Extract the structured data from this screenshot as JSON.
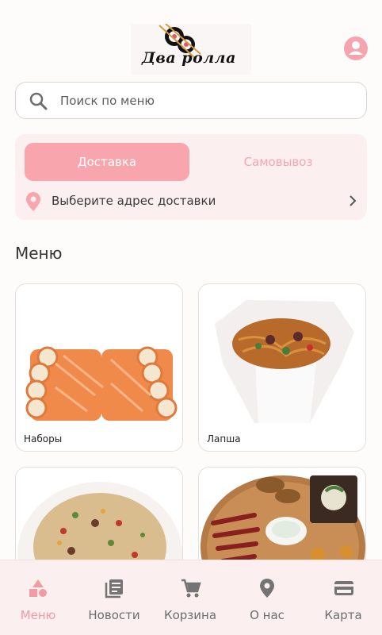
{
  "brand": {
    "name": "Два ролла",
    "accent": "#f8a5ae",
    "accent_dark": "#f39aa5",
    "background": "#fefbfb",
    "panel": "#fbefef"
  },
  "header": {
    "profile_icon": "user-circle-icon"
  },
  "search": {
    "placeholder": "Поиск по меню",
    "value": "",
    "icon": "search-icon"
  },
  "order_mode": {
    "tabs": [
      {
        "label": "Доставка",
        "active": true
      },
      {
        "label": "Самовывоз",
        "active": false
      }
    ],
    "address_prompt": "Выберите адрес доставки",
    "address_icon": "location-pin-icon",
    "chevron_icon": "chevron-right-icon"
  },
  "menu": {
    "title": "Меню",
    "categories": [
      {
        "name": "Наборы",
        "image": "sushi-set-image"
      },
      {
        "name": "Лапша",
        "image": "noodles-box-image"
      },
      {
        "name": "",
        "image": "fried-rice-image"
      },
      {
        "name": "",
        "image": "snack-platter-image"
      }
    ]
  },
  "bottom_nav": {
    "items": [
      {
        "label": "Меню",
        "icon": "shapes-icon",
        "active": true
      },
      {
        "label": "Новости",
        "icon": "news-icon",
        "active": false
      },
      {
        "label": "Корзина",
        "icon": "cart-icon",
        "active": false
      },
      {
        "label": "О нас",
        "icon": "location-pin-icon",
        "active": false
      },
      {
        "label": "Карта",
        "icon": "credit-card-icon",
        "active": false
      }
    ]
  }
}
